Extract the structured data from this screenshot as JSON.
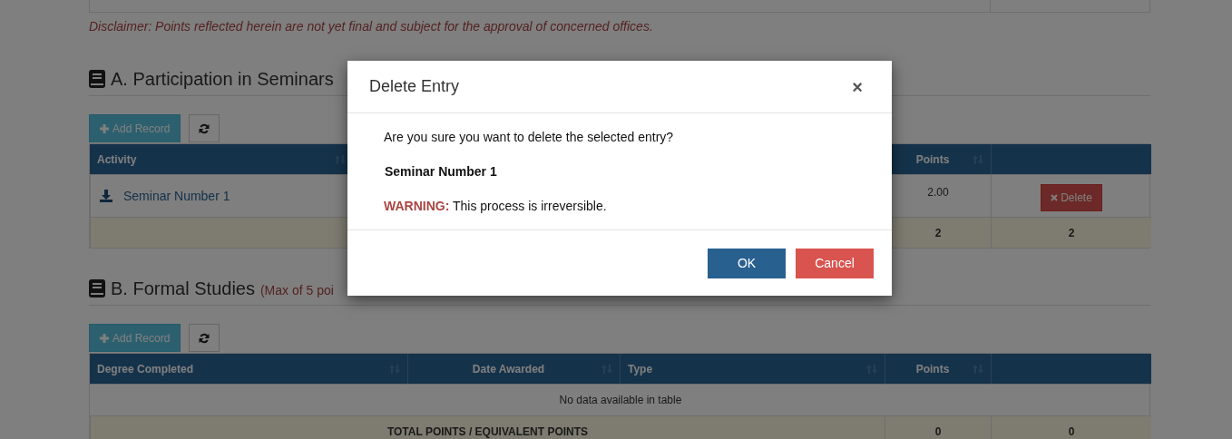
{
  "disclaimer": "Disclaimer: Points reflected herein are not yet final and subject for the approval of concerned offices.",
  "sections": [
    {
      "title": "A. Participation in Seminars",
      "add_button": "Add Record",
      "columns": [
        "Activity",
        "Points"
      ],
      "rows": [
        {
          "activity": "Seminar Number 1",
          "points": "2.00",
          "action": "Delete"
        }
      ],
      "totals": [
        "2",
        "2"
      ]
    },
    {
      "title": "B. Formal Studies",
      "note": "(Max of 5 poi",
      "add_button": "Add Record",
      "columns": [
        "Degree Completed",
        "Date Awarded",
        "Type",
        "Points"
      ],
      "empty_message": "No data available in table",
      "total_label": "TOTAL POINTS / EQUIVALENT POINTS",
      "totals": [
        "0",
        "0"
      ]
    }
  ],
  "dialog": {
    "title": "Delete Entry",
    "close": "×",
    "question": "Are you sure you want to delete the selected entry?",
    "entry": "Seminar Number 1",
    "warning_label": "WARNING:",
    "warning_text": "This process is irreversible.",
    "buttons": [
      {
        "label": "OK",
        "kind": "primary"
      },
      {
        "label": "Cancel",
        "kind": "danger"
      }
    ]
  }
}
